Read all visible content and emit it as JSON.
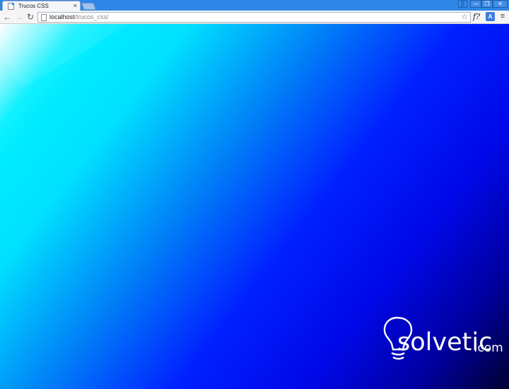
{
  "browser": {
    "tab": {
      "title": "Trucos CSS",
      "close_glyph": "×",
      "favicon": "page-icon"
    },
    "window_controls": {
      "user": "👤",
      "minimize": "—",
      "maximize": "❐",
      "close": "✕"
    },
    "nav": {
      "back": "←",
      "forward": "→",
      "reload": "↻"
    },
    "address": {
      "host": "localhost",
      "path": "/trucos_css/"
    },
    "icons": {
      "bookmark": "☆",
      "extension_f": "f?",
      "translate": "A",
      "menu": "≡"
    }
  },
  "watermark": {
    "text": "solvetic",
    "suffix": ".com"
  },
  "colors": {
    "titlebar": "#2f86e6",
    "gradient_start": "#ffffff",
    "gradient_mid": "#00e0ff",
    "gradient_blue": "#0020ff",
    "gradient_end": "#000030"
  }
}
